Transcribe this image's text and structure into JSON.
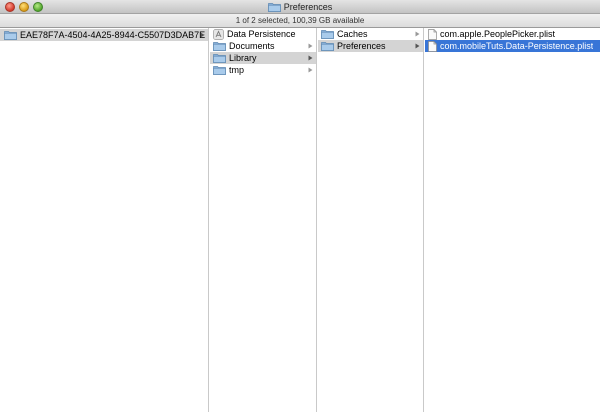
{
  "window": {
    "title": "Preferences"
  },
  "status": {
    "text": "1 of 2 selected, 100,39 GB available"
  },
  "columns": {
    "col1": {
      "items": [
        {
          "label": "EAE78F7A-4504-4A25-8944-C5507D3DAB7E",
          "icon": "folder-icon"
        }
      ]
    },
    "col2": {
      "items": [
        {
          "label": "Data Persistence",
          "icon": "app-icon"
        },
        {
          "label": "Documents",
          "icon": "folder-icon"
        },
        {
          "label": "Library",
          "icon": "folder-icon"
        },
        {
          "label": "tmp",
          "icon": "folder-icon"
        }
      ]
    },
    "col3": {
      "items": [
        {
          "label": "Caches",
          "icon": "folder-icon"
        },
        {
          "label": "Preferences",
          "icon": "folder-icon"
        }
      ]
    },
    "col4": {
      "items": [
        {
          "label": "com.apple.PeoplePicker.plist",
          "icon": "document-icon"
        },
        {
          "label": "com.mobileTuts.Data-Persistence.plist",
          "icon": "document-icon"
        }
      ]
    }
  },
  "colors": {
    "selection_active": "#3875d7",
    "selection_inactive": "#d4d4d4",
    "folder": "#8fb6dc"
  }
}
